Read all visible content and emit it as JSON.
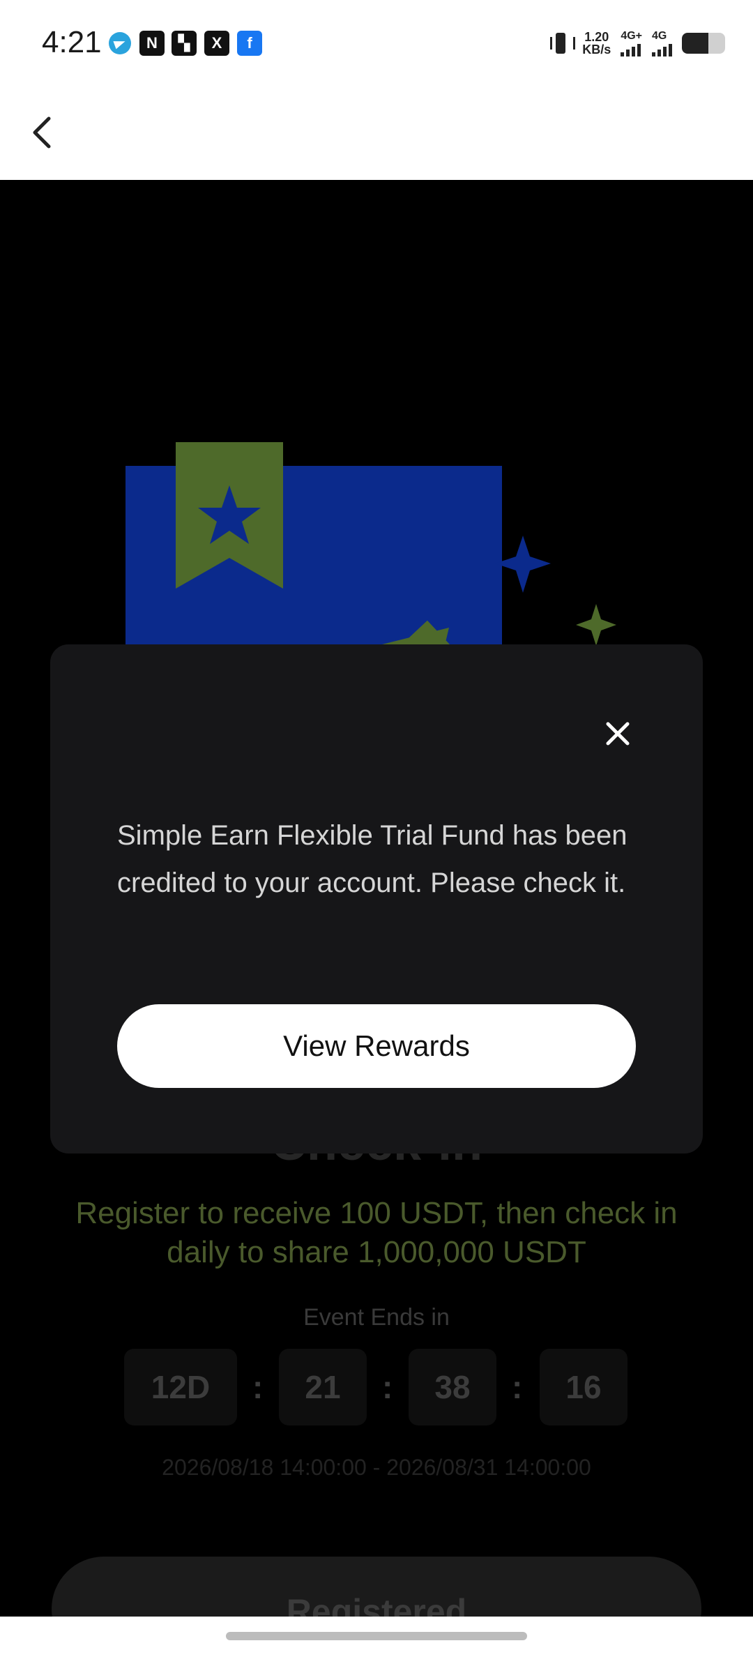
{
  "status_bar": {
    "time": "4:21",
    "notifications": [
      "telegram-icon",
      "notion-icon",
      "okx-icon",
      "x-icon",
      "facebook-icon"
    ],
    "net_speed_value": "1.20",
    "net_speed_unit": "KB/s",
    "sim1_label": "4G+",
    "sim2_label": "4G",
    "battery_level": 0.62
  },
  "header": {
    "back_icon": "chevron-left-icon"
  },
  "event": {
    "title": "Check-in",
    "subtitle": "Register to receive 100 USDT, then check in daily to share 1,000,000 USDT",
    "ends_label": "Event Ends in",
    "countdown": {
      "days": "12D",
      "hours": "21",
      "minutes": "38",
      "seconds": "16"
    },
    "separator": ":",
    "date_range": "2026/08/18 14:00:00 - 2026/08/31 14:00:00",
    "registered_label": "Registered"
  },
  "modal": {
    "message": "Simple Earn Flexible Trial Fund has been credited to your account. Please check it.",
    "button_label": "View Rewards",
    "close_icon": "close-icon"
  },
  "colors": {
    "hero_blue": "#0b2a8c",
    "hero_green": "#4e6a2a",
    "subtitle_green": "#4a5a2c",
    "modal_bg": "#161618"
  }
}
